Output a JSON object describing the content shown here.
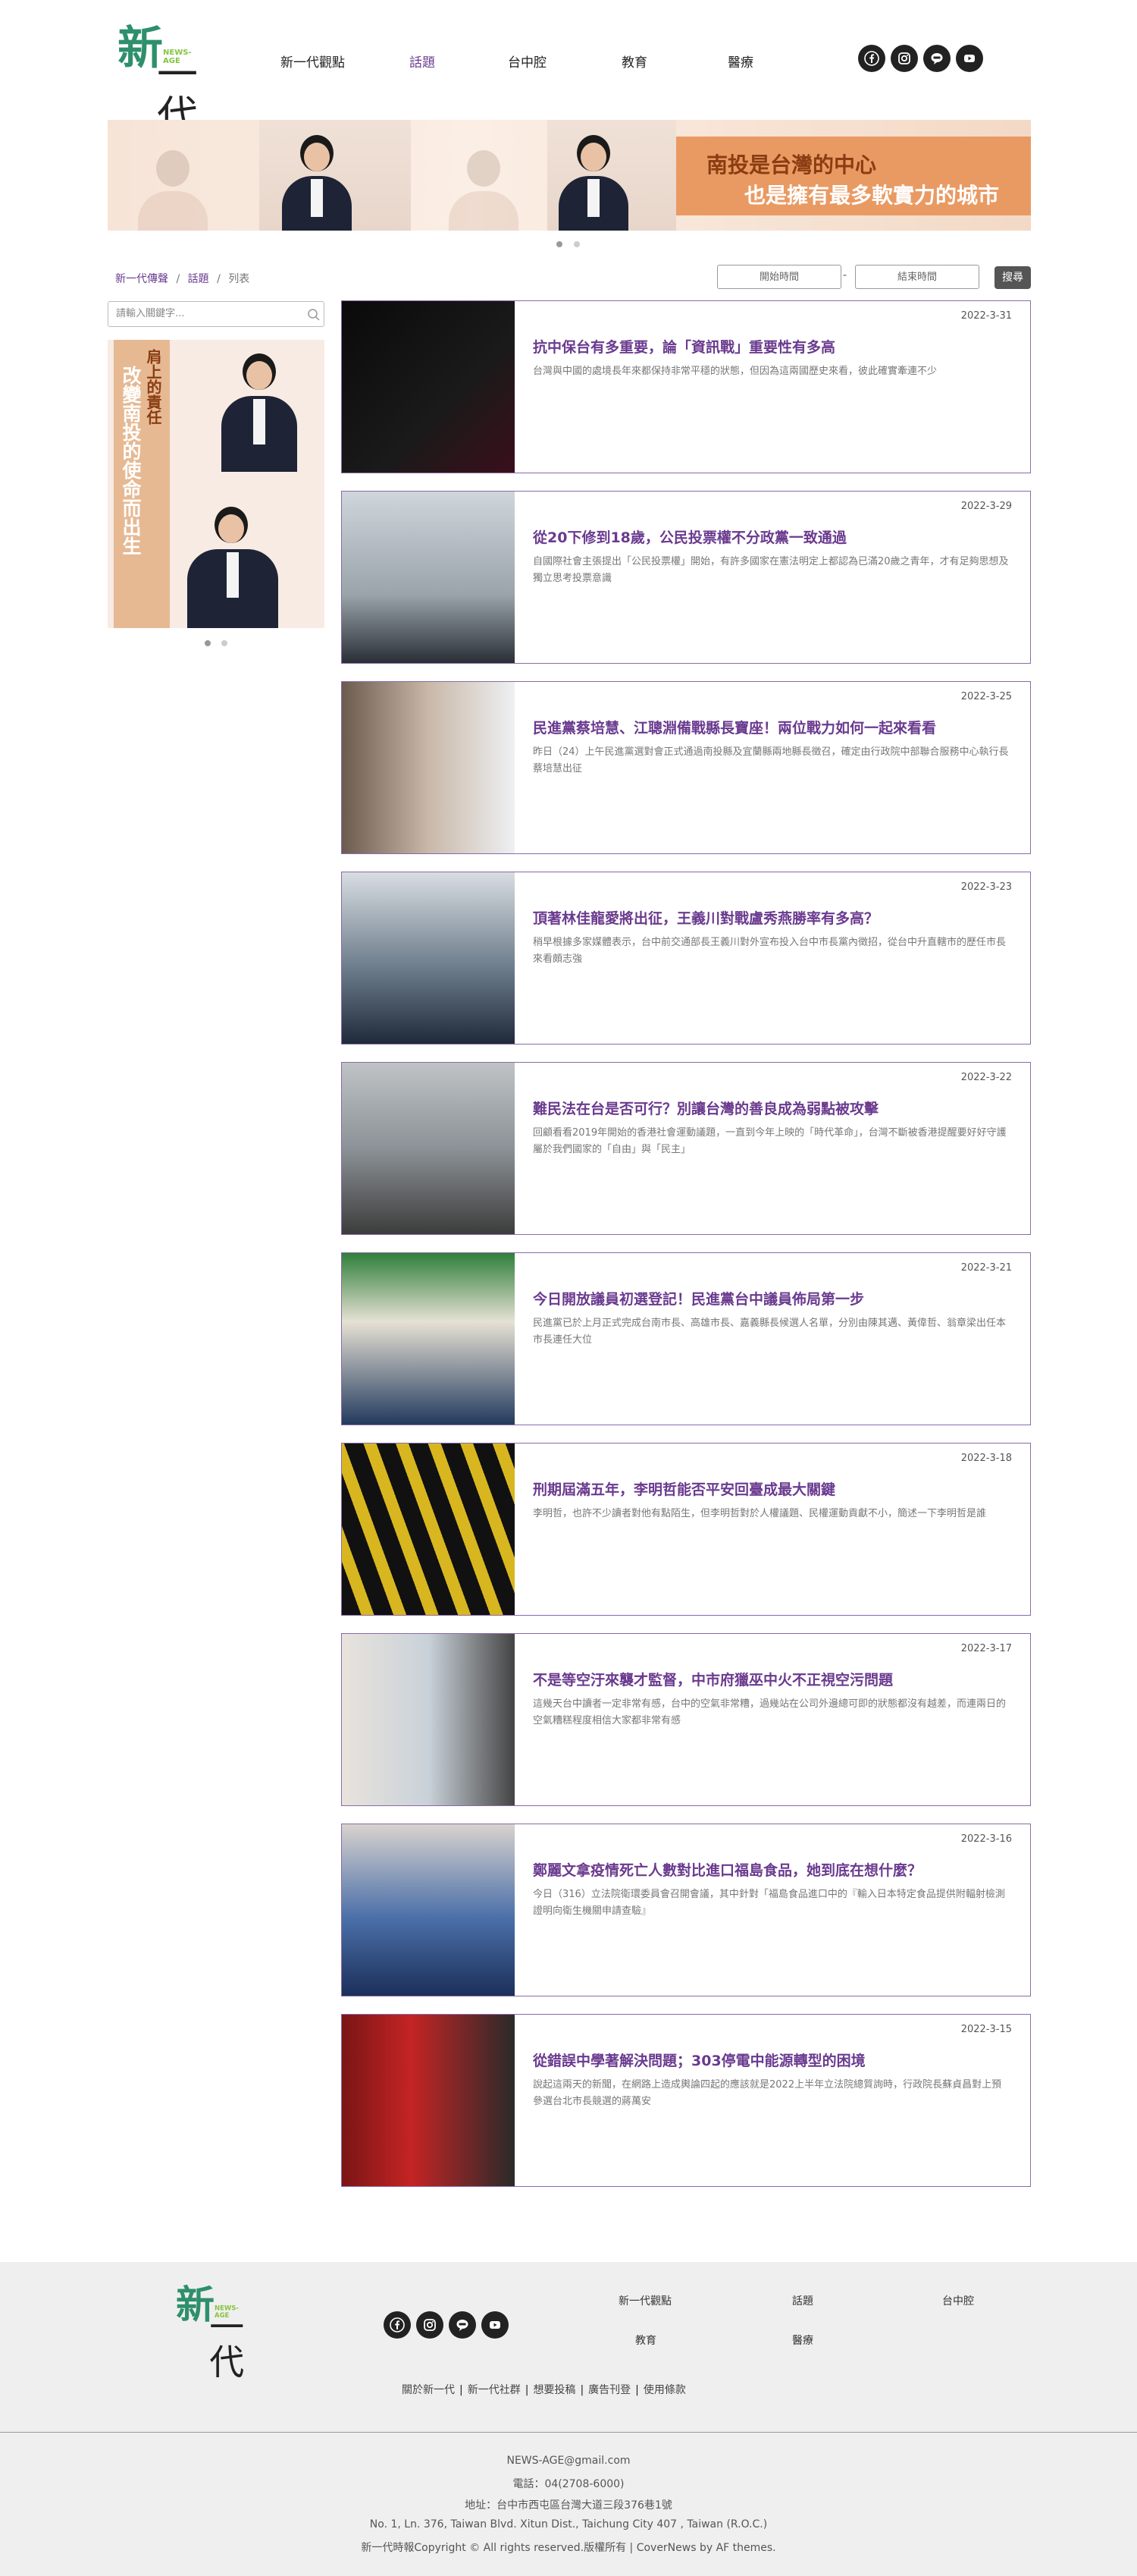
{
  "site": {
    "logo_tag": "NEWS-AGE",
    "logo_char_a": "新",
    "logo_char_b": "一代"
  },
  "nav": [
    "新一代觀點",
    "話題",
    "台中腔",
    "教育",
    "醫療"
  ],
  "nav_active_index": 1,
  "social_icons": [
    "facebook-icon",
    "instagram-icon",
    "line-icon",
    "youtube-icon"
  ],
  "banner": {
    "line1": "南投是台灣的中心",
    "line2": "也是擁有最多軟實力的城市"
  },
  "breadcrumb": {
    "home": "新一代傳聲",
    "section": "話題",
    "current": "列表",
    "sep": "/"
  },
  "filter": {
    "start_placeholder": "開始時間",
    "end_placeholder": "結束時間",
    "dash": "-",
    "search_label": "搜尋"
  },
  "sidebar": {
    "keyword_placeholder": "請輸入關鍵字...",
    "promo_line1": "肩上的責任",
    "promo_line2": "改變南投的使命而出生"
  },
  "articles": [
    {
      "date": "2022-3-31",
      "title": "抗中保台有多重要，論「資訊戰」重要性有多高",
      "excerpt": "台灣與中國的處境長年來都保持非常平穩的狀態，但因為這兩國歷史來看，彼此確實牽連不少"
    },
    {
      "date": "2022-3-29",
      "title": "從20下修到18歲，公民投票權不分政黨一致通過",
      "excerpt": "自國際社會主張提出「公民投票權」開始，有許多國家在憲法明定上都認為已滿20歲之青年，才有足夠思想及獨立思考投票意識"
    },
    {
      "date": "2022-3-25",
      "title": "民進黨蔡培慧、江聰淵備戰縣長寶座！兩位戰力如何一起來看看",
      "excerpt": "昨日（24）上午民進黨選對會正式通過南投縣及宜蘭縣兩地縣長徵召，確定由行政院中部聯合服務中心執行長蔡培慧出征"
    },
    {
      "date": "2022-3-23",
      "title": "頂著林佳龍愛將出征，王義川對戰盧秀燕勝率有多高？",
      "excerpt": "稍早根據多家媒體表示，台中前交通部長王義川對外宣布投入台中市長黨內徵招，從台中升直轄市的歷任市長來看頗志強"
    },
    {
      "date": "2022-3-22",
      "title": "難民法在台是否可行？別讓台灣的善良成為弱點被攻擊",
      "excerpt": "回顧看看2019年開始的香港社會運動議題，一直到今年上映的「時代革命」，台灣不斷被香港提醒要好好守護屬於我們國家的「自由」與「民主」"
    },
    {
      "date": "2022-3-21",
      "title": "今日開放議員初選登記！民進黨台中議員佈局第一步",
      "excerpt": "民進黨已於上月正式完成台南市長、高雄市長、嘉義縣長候選人名單，分別由陳其邁、黃偉哲、翁章梁出任本市長連任大位"
    },
    {
      "date": "2022-3-18",
      "title": "刑期屆滿五年，李明哲能否平安回臺成最大關鍵",
      "excerpt": "李明哲，也許不少讀者對他有點陌生，但李明哲對於人權議題、民權運動貢獻不小，簡述一下李明哲是誰"
    },
    {
      "date": "2022-3-17",
      "title": "不是等空汙來襲才監督，中市府獵巫中火不正視空污問題",
      "excerpt": "這幾天台中讀者一定非常有感，台中的空氣非常糟，過幾站在公司外邊總可即的狀態都沒有越差，而連兩日的空氣糟糕程度相信大家都非常有感"
    },
    {
      "date": "2022-3-16",
      "title": "鄭麗文拿疫情死亡人數對比進口福島食品，她到底在想什麼？",
      "excerpt": "今日（316）立法院衛環委員會召開會議，其中針對「福島食品進口中的『輸入日本特定食品提供附輻射檢測證明向衛生機關申請查驗』"
    },
    {
      "date": "2022-3-15",
      "title": "從錯誤中學著解決問題；303停電中能源轉型的困境",
      "excerpt": "說起這兩天的新聞，在網路上造成輿論四起的應該就是2022上半年立法院總質詢時，行政院長蘇貞昌對上預參選台北市長競選的蔣萬安"
    }
  ],
  "footer": {
    "links": [
      "新一代觀點",
      "話題",
      "台中腔",
      "教育",
      "醫療"
    ],
    "bar": [
      "關於新一代",
      "新一代社群",
      "想要投稿",
      "廣告刊登",
      "使用條款"
    ],
    "bar_sep": "|",
    "email": "NEWS-AGE@gmail.com",
    "phone": "電話：04(2708-6000)",
    "address_zh": "地址：台中市西屯區台灣大道三段376巷1號",
    "address_en": "No. 1, Ln. 376, Taiwan Blvd. Xitun Dist., Taichung City 407 , Taiwan (R.O.C.)",
    "copyright": "新一代時報Copyright © All rights reserved.版權所有 | CoverNews by AF themes."
  }
}
